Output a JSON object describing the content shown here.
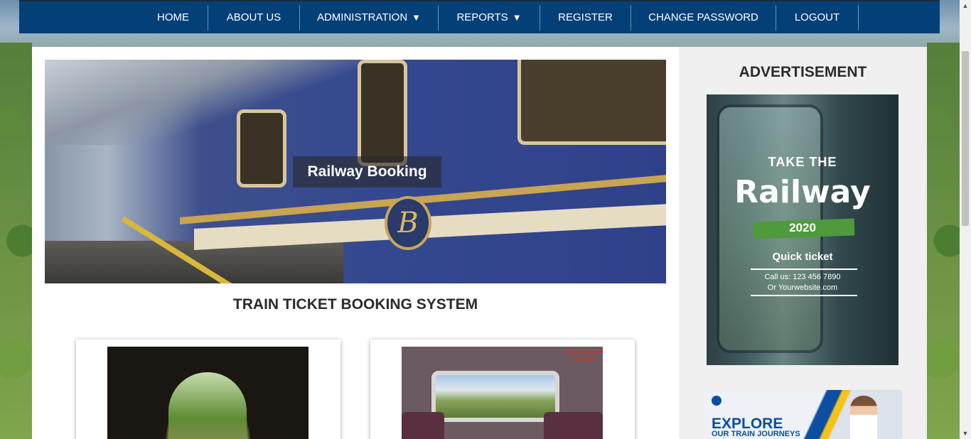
{
  "nav": {
    "home": "HOME",
    "about": "ABOUT US",
    "administration": "ADMINISTRATION",
    "reports": "REPORTS",
    "register": "REGISTER",
    "change_password": "CHANGE PASSWORD",
    "logout": "LOGOUT",
    "caret": "▼"
  },
  "hero": {
    "caption": "Railway Booking",
    "logo_letter": "B"
  },
  "main": {
    "title": "TRAIN TICKET BOOKING SYSTEM"
  },
  "cards": {
    "window_sign": "Have a quiet carriage"
  },
  "sidebar": {
    "title": "ADVERTISEMENT",
    "ad1": {
      "take": "TAKE THE",
      "railway": "Railway",
      "year": "2020",
      "quick": "Quick ticket",
      "call": "Call us: 123 456 7890",
      "website": "Or Yourwebsite.com"
    },
    "ad2": {
      "explore": "EXPLORE",
      "journeys": "OUR TRAIN JOURNEYS"
    }
  },
  "scrollbar": {
    "up": "▲",
    "down": "▼"
  },
  "colors": {
    "nav_bg": "#034078",
    "content_bg": "#ffffff",
    "sidebar_bg": "#f0f0f0"
  }
}
